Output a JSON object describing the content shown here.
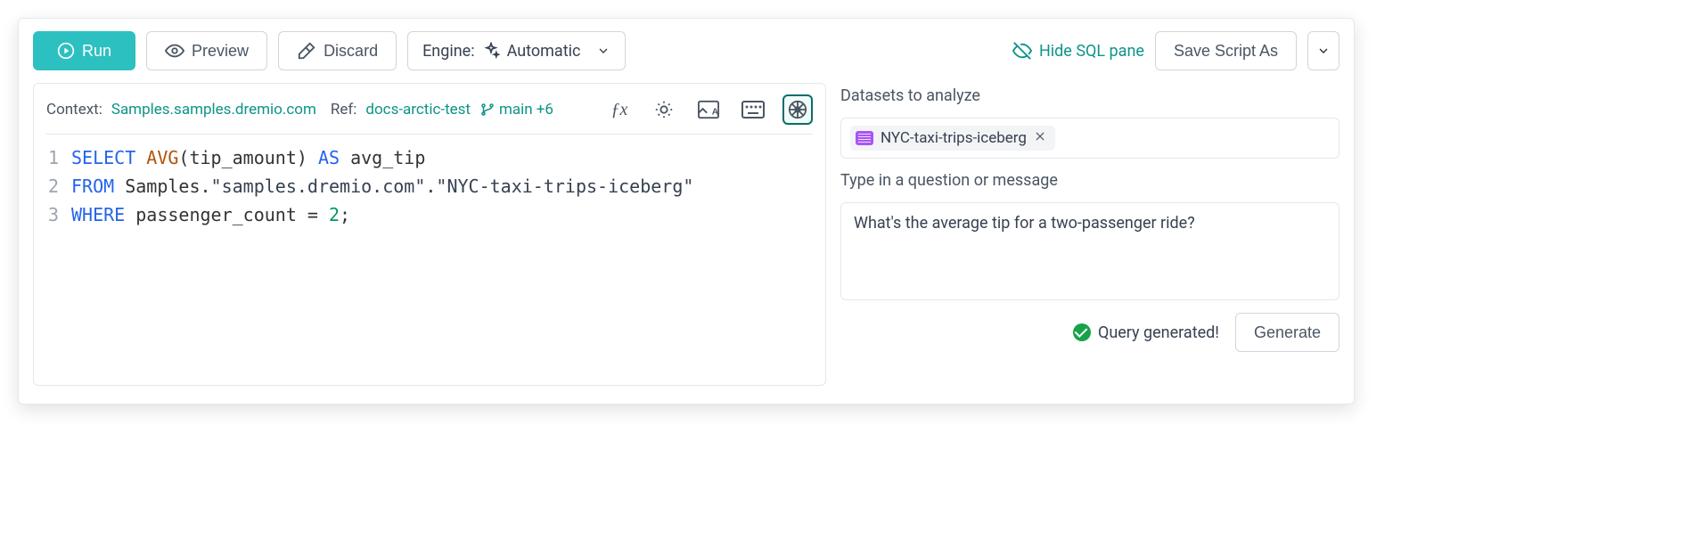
{
  "toolbar": {
    "run_label": "Run",
    "preview_label": "Preview",
    "discard_label": "Discard",
    "engine_label_prefix": "Engine:",
    "engine_value": "Automatic",
    "hide_sql_label": "Hide SQL pane",
    "save_script_label": "Save Script As"
  },
  "context": {
    "label": "Context:",
    "path": "Samples.samples.dremio.com",
    "ref_label": "Ref:",
    "ref_value": "docs-arctic-test",
    "branch_label": "main",
    "branch_extra": "+6"
  },
  "sql_lines": [
    {
      "n": "1",
      "tokens": [
        {
          "t": "SELECT",
          "c": "kw"
        },
        {
          "t": " "
        },
        {
          "t": "AVG",
          "c": "fn"
        },
        {
          "t": "(tip_amount) "
        },
        {
          "t": "AS",
          "c": "kw"
        },
        {
          "t": " avg_tip"
        }
      ]
    },
    {
      "n": "2",
      "tokens": [
        {
          "t": "FROM",
          "c": "kw"
        },
        {
          "t": "   Samples."
        },
        {
          "t": "\"samples.dremio.com\"",
          "c": "str"
        },
        {
          "t": "."
        },
        {
          "t": "\"NYC-taxi-trips-iceberg\"",
          "c": "str"
        }
      ]
    },
    {
      "n": "3",
      "tokens": [
        {
          "t": "WHERE",
          "c": "kw"
        },
        {
          "t": "  passenger_count = "
        },
        {
          "t": "2",
          "c": "num"
        },
        {
          "t": ";"
        }
      ]
    }
  ],
  "side": {
    "datasets_label": "Datasets to analyze",
    "dataset_chip": "NYC-taxi-trips-iceberg",
    "question_label": "Type in a question or message",
    "question_value": "What's the average tip for a two-passenger ride?",
    "status_text": "Query generated!",
    "generate_label": "Generate"
  }
}
